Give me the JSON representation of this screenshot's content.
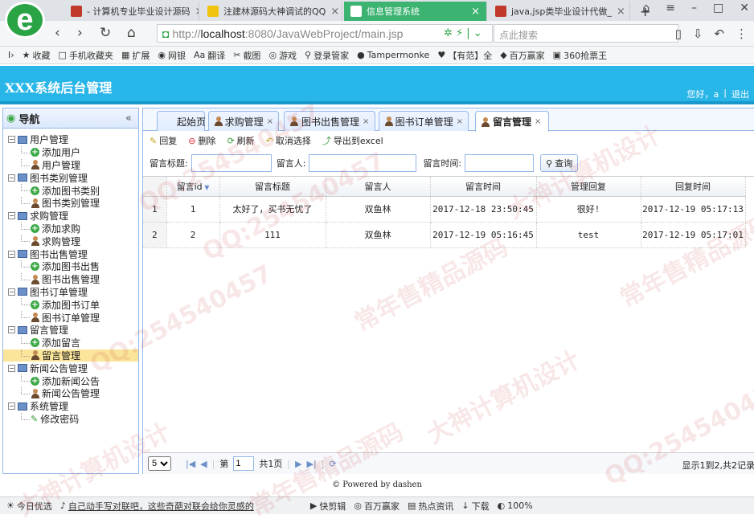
{
  "browser": {
    "tabs": [
      {
        "title": "- 计算机专业毕业设计源码",
        "color": "#c0392b"
      },
      {
        "title": "注建林源码大神调试的QQ",
        "color": "#f1c40f"
      },
      {
        "title": "信息管理系统",
        "color": "#ffffff"
      },
      {
        "title": "java,jsp类毕业设计代做_",
        "color": "#c0392b"
      }
    ],
    "new_tab": "+",
    "url_prefix": "http://",
    "url_host": "localhost",
    "url_rest": ":8080/JavaWebProject/main.jsp",
    "search_placeholder": "点此搜索",
    "favorites": [
      {
        "icon": "★",
        "label": "收藏"
      },
      {
        "icon": "□",
        "label": "手机收藏夹"
      },
      {
        "icon": "▦",
        "label": "扩展"
      },
      {
        "icon": "◉",
        "label": "网银"
      },
      {
        "icon": "Aa",
        "label": "翻译"
      },
      {
        "icon": "✂",
        "label": "截图"
      },
      {
        "icon": "◎",
        "label": "游戏"
      },
      {
        "icon": "⚲",
        "label": "登录管家"
      },
      {
        "icon": "●",
        "label": "Tampermonke"
      },
      {
        "icon": "♥",
        "label": "【有范】全"
      },
      {
        "icon": "◆",
        "label": "百万赢家"
      },
      {
        "icon": "▣",
        "label": "360抢票王"
      }
    ]
  },
  "app": {
    "title": "XXX系统后台管理",
    "greeting": "您好，a",
    "logout": "退出"
  },
  "sidebar": {
    "title": "导航",
    "groups": [
      {
        "label": "用户管理",
        "items": [
          {
            "label": "添加用户",
            "type": "add"
          },
          {
            "label": "用户管理",
            "type": "user"
          }
        ]
      },
      {
        "label": "图书类别管理",
        "items": [
          {
            "label": "添加图书类别",
            "type": "add"
          },
          {
            "label": "图书类别管理",
            "type": "user"
          }
        ]
      },
      {
        "label": "求购管理",
        "items": [
          {
            "label": "添加求购",
            "type": "add"
          },
          {
            "label": "求购管理",
            "type": "user"
          }
        ]
      },
      {
        "label": "图书出售管理",
        "items": [
          {
            "label": "添加图书出售",
            "type": "add"
          },
          {
            "label": "图书出售管理",
            "type": "user"
          }
        ]
      },
      {
        "label": "图书订单管理",
        "items": [
          {
            "label": "添加图书订单",
            "type": "add"
          },
          {
            "label": "图书订单管理",
            "type": "user"
          }
        ]
      },
      {
        "label": "留言管理",
        "items": [
          {
            "label": "添加留言",
            "type": "add"
          },
          {
            "label": "留言管理",
            "type": "user",
            "selected": true
          }
        ]
      },
      {
        "label": "新闻公告管理",
        "items": [
          {
            "label": "添加新闻公告",
            "type": "add"
          },
          {
            "label": "新闻公告管理",
            "type": "user"
          }
        ]
      },
      {
        "label": "系统管理",
        "items": [
          {
            "label": "修改密码",
            "type": "pen"
          }
        ]
      }
    ]
  },
  "panel_tabs": [
    {
      "label": "起始页",
      "closable": false
    },
    {
      "label": "求购管理",
      "closable": true
    },
    {
      "label": "图书出售管理",
      "closable": true
    },
    {
      "label": "图书订单管理",
      "closable": true
    },
    {
      "label": "留言管理",
      "closable": true,
      "active": true
    }
  ],
  "toolbar": {
    "reply": "回复",
    "delete": "删除",
    "refresh": "刷新",
    "cancel_select": "取消选择",
    "export": "导出到excel"
  },
  "search": {
    "title_label": "留言标题:",
    "person_label": "留言人:",
    "time_label": "留言时间:",
    "query": "查询"
  },
  "grid": {
    "columns": [
      "留言id",
      "留言标题",
      "留言人",
      "留言时间",
      "管理回复",
      "回复时间"
    ],
    "rows": [
      {
        "rownum": "1",
        "cells": [
          "1",
          "太好了，买书无忧了",
          "双鱼林",
          "2017-12-18 23:50:45",
          "很好!",
          "2017-12-19 05:17:13"
        ]
      },
      {
        "rownum": "2",
        "cells": [
          "2",
          "111",
          "双鱼林",
          "2017-12-19 05:16:45",
          "test",
          "2017-12-19 05:17:01"
        ]
      }
    ]
  },
  "pager": {
    "page_size": "5",
    "page_prefix": "第",
    "page_value": "1",
    "page_suffix": "共1页",
    "info": "显示1到2,共2记录"
  },
  "footer": "© Powered by dashen",
  "statusbar": [
    "今日优选",
    "自己动手写对联吧，这些奇葩对联会给你灵感的",
    "快剪辑",
    "百万赢家",
    "热点资讯",
    "下载",
    "100%"
  ],
  "watermarks": [
    "QQ:254540457",
    "大神计算机设计",
    "常年售精品源码"
  ]
}
